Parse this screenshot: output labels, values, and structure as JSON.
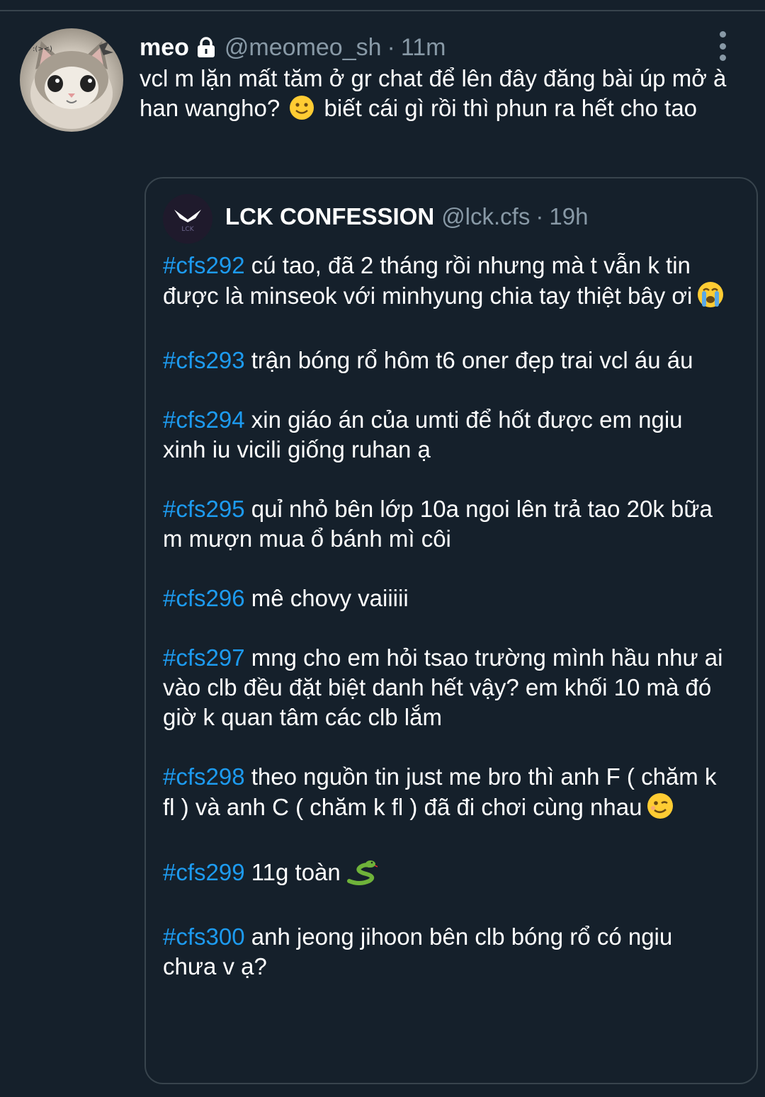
{
  "tweet": {
    "display_name": "meo",
    "handle": "@meomeo_sh",
    "separator": "·",
    "time": "11m",
    "text_before_emoji": "vcl m lặn mất tăm ở gr chat để lên đây đăng bài úp mở à han wangho?",
    "emoji": "slightly-smiling-face",
    "text_after_emoji": "biết cái gì rồi thì phun ra hết cho tao"
  },
  "quote": {
    "display_name": "LCK CONFESSION",
    "handle": "@lck.cfs",
    "separator": "·",
    "time": "19h",
    "posts": [
      {
        "tag": "#cfs292",
        "text": " cú tao, đã 2 tháng rồi nhưng mà t vẫn k tin được là minseok với minhyung chia tay thiệt bây ơi",
        "emoji": "loudly-crying-face"
      },
      {
        "tag": "#cfs293",
        "text": " trận bóng rổ hôm t6 oner đẹp trai vcl áu áu",
        "emoji": ""
      },
      {
        "tag": "#cfs294",
        "text": " xin giáo án của umti để hốt được em ngiu xinh iu vicili giống ruhan ạ",
        "emoji": ""
      },
      {
        "tag": "#cfs295",
        "text": " quỉ nhỏ bên lớp 10a ngoi lên trả tao 20k bữa m mượn mua ổ bánh mì côi",
        "emoji": ""
      },
      {
        "tag": "#cfs296",
        "text": " mê chovy vaiiiii",
        "emoji": ""
      },
      {
        "tag": "#cfs297",
        "text": " mng cho em hỏi tsao trường mình hầu như ai vào clb đều đặt biệt danh hết vậy? em khối 10 mà đó giờ k quan tâm các clb lắm",
        "emoji": ""
      },
      {
        "tag": "#cfs298",
        "text": " theo nguồn tin just me bro thì anh F ( chăm k fl ) và anh C ( chăm k fl ) đã đi chơi cùng nhau",
        "emoji": "winking-face"
      },
      {
        "tag": "#cfs299",
        "text": " 11g toàn",
        "emoji": "snake"
      },
      {
        "tag": "#cfs300",
        "text": " anh jeong jihoon bên clb bóng rổ có ngiu chưa v ạ?",
        "emoji": ""
      }
    ]
  },
  "colors": {
    "background": "#15202b",
    "hashtag": "#1d9bf0",
    "secondary_text": "#8899a6",
    "border": "#38444d"
  }
}
